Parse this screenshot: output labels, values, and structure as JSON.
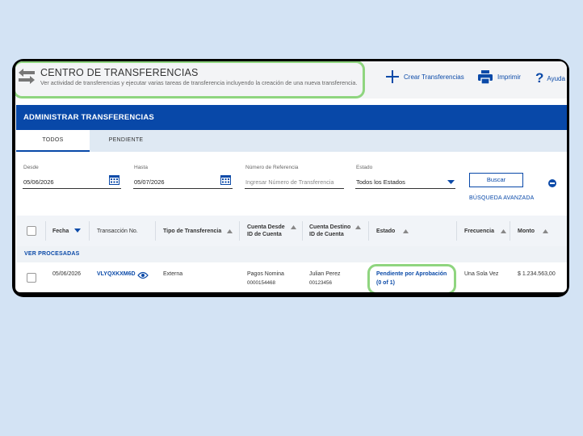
{
  "header": {
    "title": "CENTRO DE TRANSFERENCIAS",
    "subtitle": "Ver actividad de transferencias y ejecutar varias tareas de transferencia incluyendo la creación de una nueva transferencia."
  },
  "actions": {
    "create_label": "Crear Transferencias",
    "print_label": "Imprimir",
    "help_label": "Ayuda"
  },
  "section_title": "ADMINISTRAR TRANSFERENCIAS",
  "tabs": [
    {
      "label": "TODOS",
      "active": true
    },
    {
      "label": "PENDIENTE",
      "active": false
    }
  ],
  "filters": {
    "from_label": "Desde",
    "from_value": "05/06/2026",
    "to_label": "Hasta",
    "to_value": "05/07/2026",
    "ref_label": "Número de Referencia",
    "ref_placeholder": "Ingresar Número de Transferencia",
    "status_label": "Estado",
    "status_value": "Todos los Estados",
    "search_button": "Buscar",
    "advanced_link": "BÚSQUEDA AVANZADA"
  },
  "table": {
    "headers": {
      "fecha": "Fecha",
      "transaccion": "Transacción No.",
      "tipo": "Tipo de Transferencia",
      "desde": "Cuenta Desde",
      "desde_sub": "ID de Cuenta",
      "destino": "Cuenta Destino",
      "destino_sub": "ID de Cuenta",
      "estado": "Estado",
      "frecuencia": "Frecuencia",
      "monto": "Monto"
    },
    "group_label": "VER PROCESADAS",
    "rows": [
      {
        "fecha": "05/06/2026",
        "transaccion": "VLYQXKXM6D",
        "tipo": "Externa",
        "desde_name": "Pagos Nomina",
        "desde_id": "0000154468",
        "destino_name": "Julian Perez",
        "destino_id": "00123456",
        "estado_line1": "Pendiente por Aprobación",
        "estado_line2": "(0 of 1)",
        "frecuencia": "Una Sola Vez",
        "monto": "$ 1.234.563,00"
      }
    ]
  },
  "colors": {
    "brand_blue": "#0848a8",
    "highlight_green": "#8fd57f",
    "page_background": "#d3e3f4"
  }
}
